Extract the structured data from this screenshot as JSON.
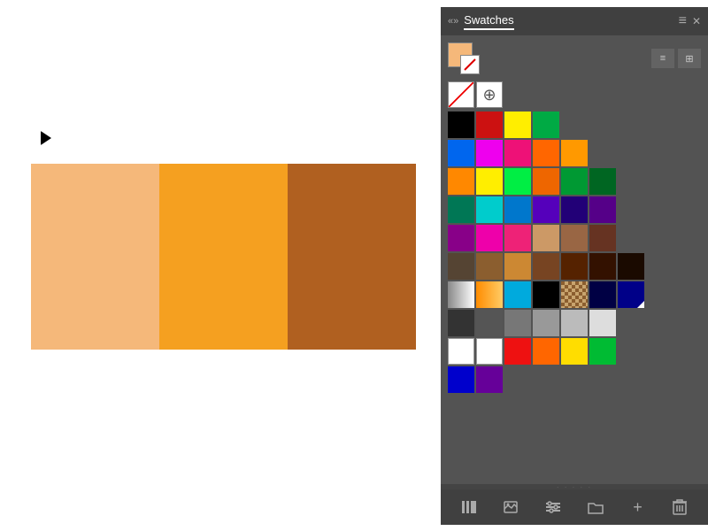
{
  "panel": {
    "title": "Swatches",
    "collapse_icon": "««",
    "close_icon": "✕",
    "menu_icon": "≡"
  },
  "canvas": {
    "colors": [
      {
        "id": "light-orange",
        "hex": "#f5b87a"
      },
      {
        "id": "medium-orange",
        "hex": "#f5a020"
      },
      {
        "id": "dark-brown-orange",
        "hex": "#b06020"
      }
    ]
  },
  "swatches": {
    "row1": [
      "#000000",
      "#ff0000",
      "#ffff00",
      "#00cc00"
    ],
    "row2": [
      "#0077ff",
      "#ff00ff",
      "#ff3399",
      "#ff6600",
      "#ff9900"
    ],
    "row3": [
      "#ff8c00",
      "#ffff00",
      "#00ff00",
      "#ff6600",
      "#00aa00",
      "#006600"
    ],
    "row4": [
      "#008800",
      "#00cccc",
      "#0099ff",
      "#6600cc",
      "#330099",
      "#660099"
    ],
    "row5": [
      "#990099",
      "#ff00cc",
      "#ff3399",
      "#cc9966",
      "#996633",
      "#663300"
    ],
    "row6": [
      "#554433",
      "#8b5e2f",
      "#cc8844",
      "#884422",
      "#663300",
      "#440000",
      "#220000"
    ],
    "row7": [
      "#888888",
      "#ff8c00",
      "#00ccff",
      "#000000",
      "#pattern",
      "#000044",
      "#000088"
    ],
    "row8": [
      "#444444",
      "#666666",
      "#888888",
      "#aaaaaa",
      "#cccccc",
      "#eeeeee"
    ],
    "row9": [
      "#ffffff",
      "#ffffff",
      "#ff0000",
      "#ff6600",
      "#ffff00",
      "#00cc00"
    ],
    "row10": [
      "#0000cc",
      "#660099"
    ]
  },
  "bottom_toolbar": {
    "library_icon": "📚",
    "place_icon": "🖼",
    "settings_icon": "⚙",
    "folder_icon": "📁",
    "add_icon": "+",
    "delete_icon": "🗑"
  }
}
